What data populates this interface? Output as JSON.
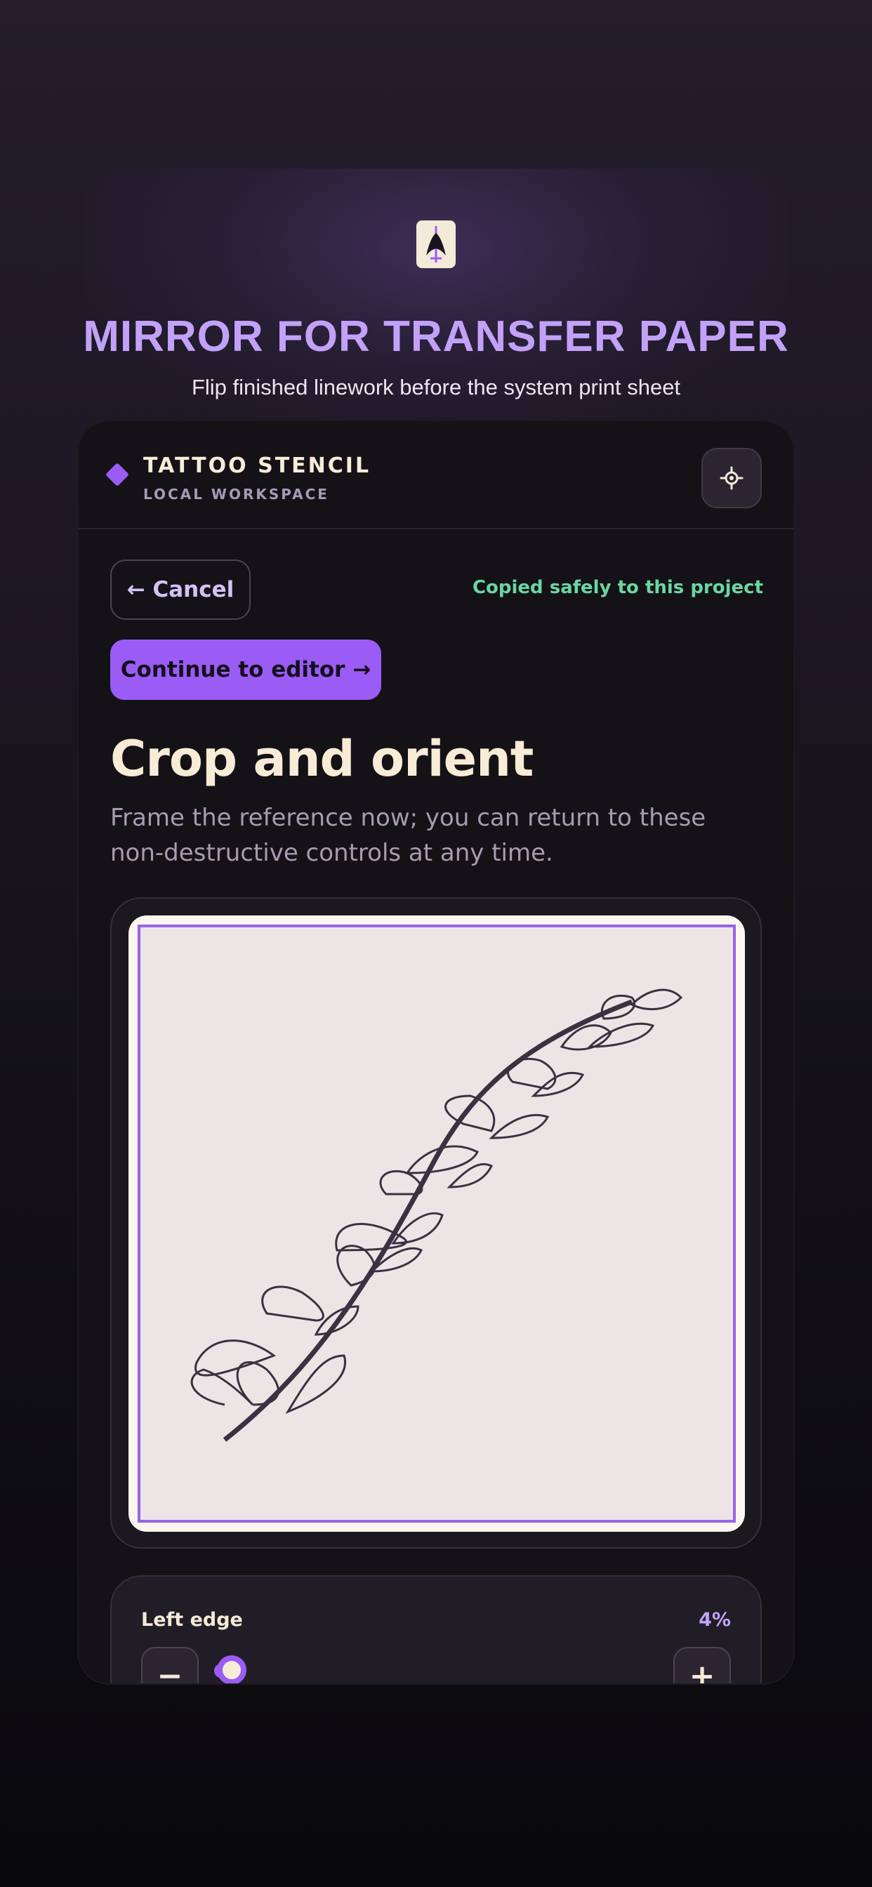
{
  "hero": {
    "title": "MIRROR FOR TRANSFER PAPER",
    "subtitle": "Flip finished linework before the system print sheet"
  },
  "header": {
    "brand_name": "TATTOO STENCIL",
    "brand_sub": "LOCAL WORKSPACE",
    "settings_icon": "gear-icon"
  },
  "actions": {
    "cancel_label": "← Cancel",
    "status": "Copied safely to this project",
    "continue_label": "Continue to editor →"
  },
  "section": {
    "title": "Crop and orient",
    "description": "Frame the reference now; you can return to these non-destructive controls at any time."
  },
  "control": {
    "label": "Left edge",
    "value": "4%",
    "level_percent": 4,
    "minus_label": "−",
    "plus_label": "+"
  },
  "colors": {
    "accent": "#9b5cf6",
    "success": "#6bd6a2",
    "cream": "#f8ecd6"
  }
}
